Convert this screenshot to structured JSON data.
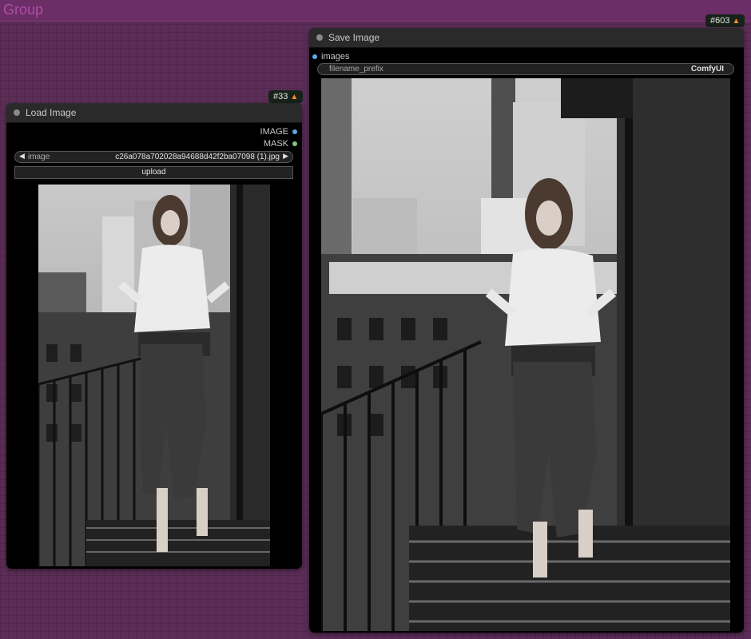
{
  "group": {
    "title": "Group"
  },
  "load_node": {
    "id_badge": "#33",
    "title": "Load Image",
    "outputs": [
      {
        "label": "IMAGE",
        "color": "#5aa9e6"
      },
      {
        "label": "MASK",
        "color": "#7ec97e"
      }
    ],
    "image_widget": {
      "label": "image",
      "value": "c26a078a702028a94688d42f2ba07098 (1).jpg"
    },
    "upload_label": "upload",
    "preview": "photo of woman on fire escape"
  },
  "save_node": {
    "id_badge": "#603",
    "title": "Save Image",
    "input": {
      "label": "images",
      "color": "#5aa9e6"
    },
    "filename_widget": {
      "label": "filename_prefix",
      "value": "ComfyUI"
    },
    "preview": "photo of woman on fire escape"
  },
  "colors": {
    "canvas": "#5b2d57",
    "group_title": "#b04ea8",
    "badge_fox": "#ff8a2a"
  }
}
